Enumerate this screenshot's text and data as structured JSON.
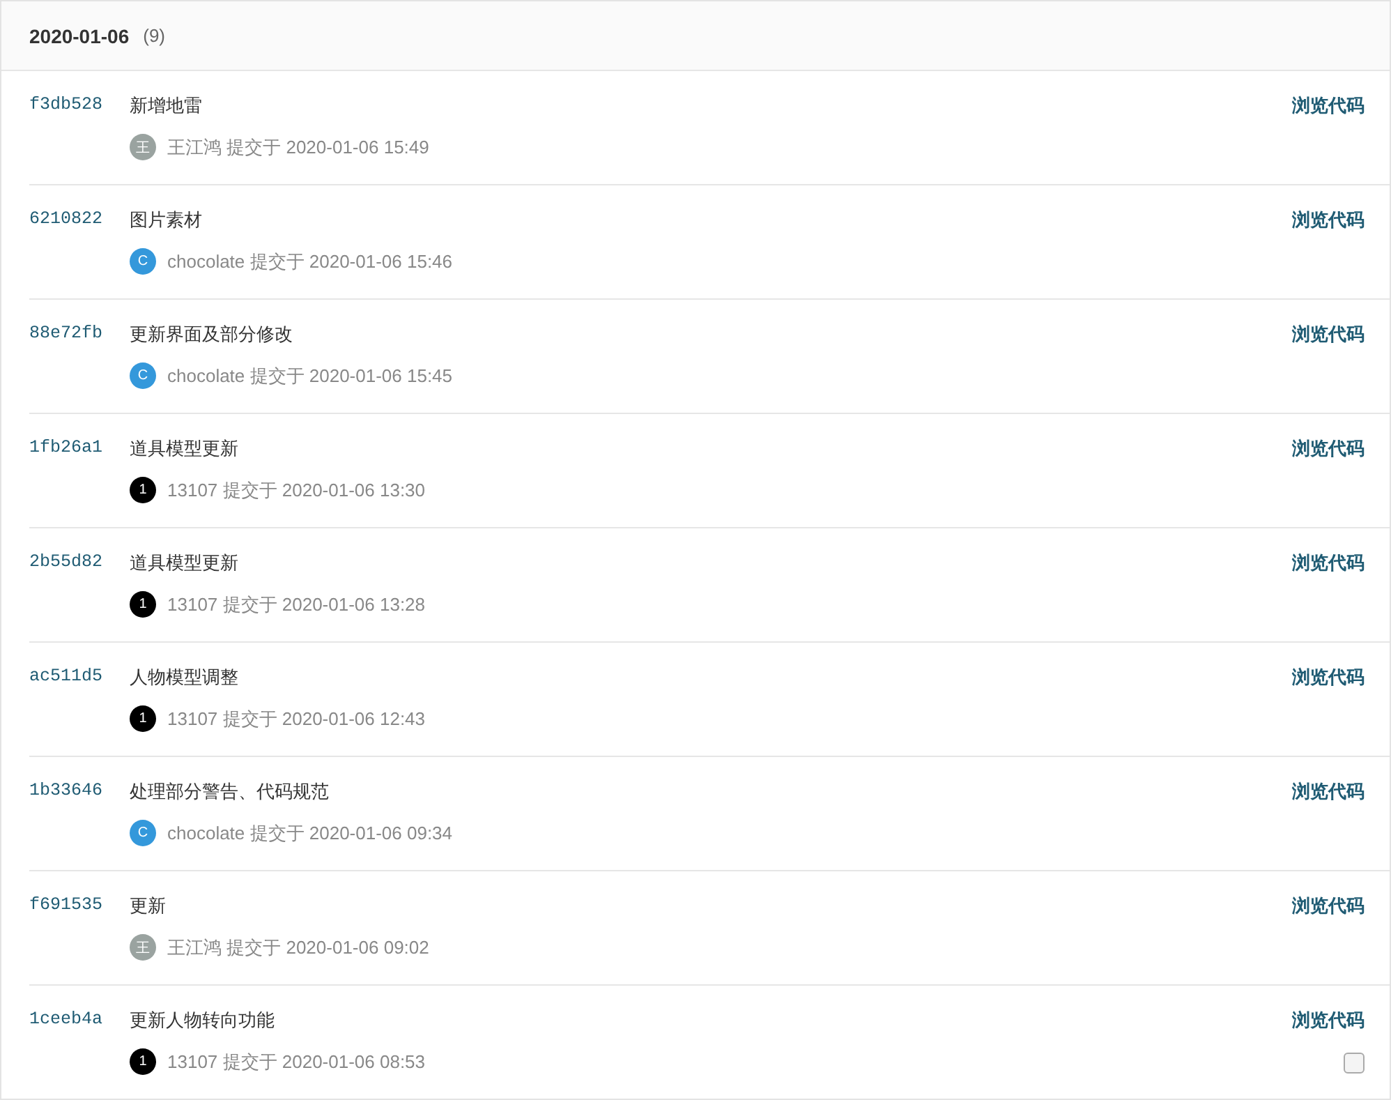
{
  "group": {
    "date": "2020-01-06",
    "count": "(9)"
  },
  "commits": [
    {
      "hash": "f3db528",
      "message": "新增地雷",
      "avatar": "王",
      "color": "#9aa3a0",
      "author": "王江鸿",
      "meta": "提交于 2020-01-06 15:49",
      "action": "浏览代码"
    },
    {
      "hash": "6210822",
      "message": "图片素材",
      "avatar": "C",
      "color": "#3498db",
      "author": "chocolate",
      "meta": "提交于 2020-01-06 15:46",
      "action": "浏览代码"
    },
    {
      "hash": "88e72fb",
      "message": "更新界面及部分修改",
      "avatar": "C",
      "color": "#3498db",
      "author": "chocolate",
      "meta": "提交于 2020-01-06 15:45",
      "action": "浏览代码"
    },
    {
      "hash": "1fb26a1",
      "message": "道具模型更新",
      "avatar": "1",
      "color": "#000000",
      "author": "13107",
      "meta": "提交于 2020-01-06 13:30",
      "action": "浏览代码"
    },
    {
      "hash": "2b55d82",
      "message": "道具模型更新",
      "avatar": "1",
      "color": "#000000",
      "author": "13107",
      "meta": "提交于 2020-01-06 13:28",
      "action": "浏览代码"
    },
    {
      "hash": "ac511d5",
      "message": "人物模型调整",
      "avatar": "1",
      "color": "#000000",
      "author": "13107",
      "meta": "提交于 2020-01-06 12:43",
      "action": "浏览代码"
    },
    {
      "hash": "1b33646",
      "message": "处理部分警告、代码规范",
      "avatar": "C",
      "color": "#3498db",
      "author": "chocolate",
      "meta": "提交于 2020-01-06 09:34",
      "action": "浏览代码"
    },
    {
      "hash": "f691535",
      "message": "更新",
      "avatar": "王",
      "color": "#9aa3a0",
      "author": "王江鸿",
      "meta": "提交于 2020-01-06 09:02",
      "action": "浏览代码"
    },
    {
      "hash": "1ceeb4a",
      "message": "更新人物转向功能",
      "avatar": "1",
      "color": "#000000",
      "author": "13107",
      "meta": "提交于 2020-01-06 08:53",
      "action": "浏览代码",
      "checked": false
    }
  ]
}
